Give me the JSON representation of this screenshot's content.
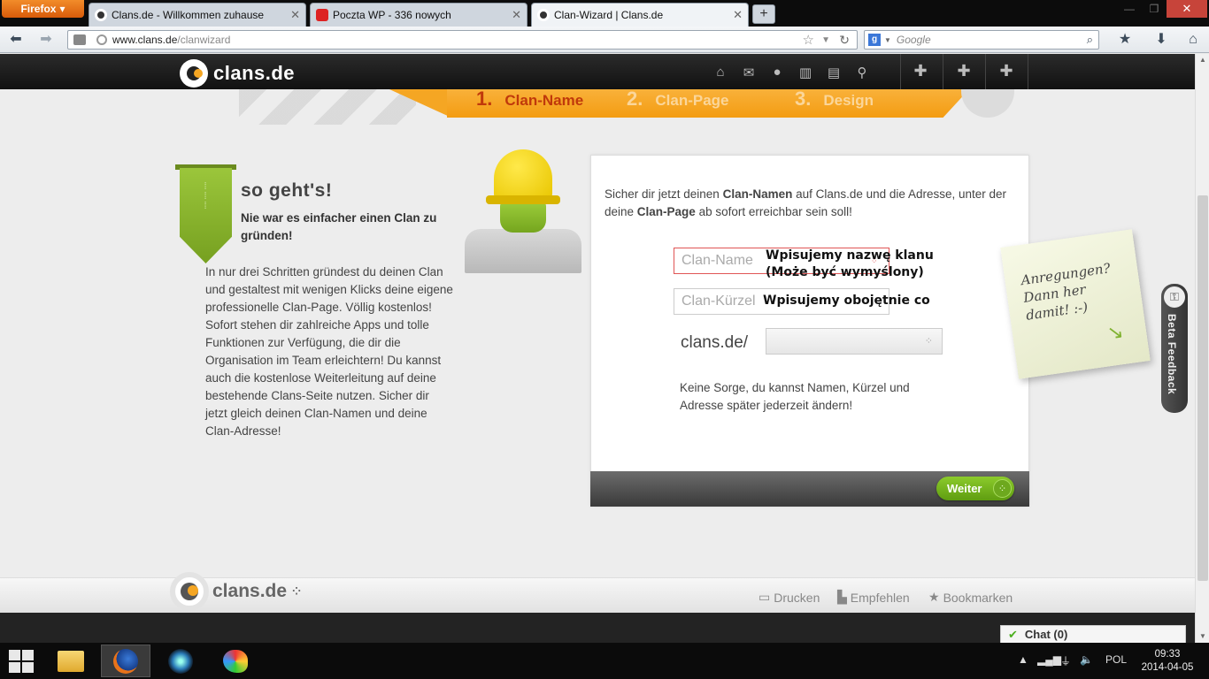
{
  "browser": {
    "menu_button": "Firefox",
    "tabs": [
      {
        "label": "Clans.de - Willkommen zuhause",
        "active": false
      },
      {
        "label": "Poczta WP - 336 nowych",
        "active": false
      },
      {
        "label": "Clan-Wizard | Clans.de",
        "active": true
      }
    ],
    "url_host": "www.clans.de",
    "url_path": "/clanwizard",
    "search_placeholder": "Google"
  },
  "site": {
    "logo_text": "clans.de",
    "steps": [
      {
        "num": "1.",
        "label": "Clan-Name"
      },
      {
        "num": "2.",
        "label": "Clan-Page"
      },
      {
        "num": "3.",
        "label": "Design"
      }
    ]
  },
  "howto": {
    "title": "so geht's!",
    "subtitle": "Nie war es einfacher einen Clan zu gründen!",
    "body": "In nur drei Schritten gründest du deinen Clan und gestaltest mit wenigen Klicks deine eigene professionelle Clan-Page. Völlig kostenlos! Sofort stehen dir zahlreiche Apps und tolle Funktionen zur Verfügung, die dir die Organisation im Team erleichtern! Du kannst auch die kostenlose Weiterleitung auf deine bestehende Clans-Seite nutzen. Sicher dir jetzt gleich deinen Clan-Namen und deine Clan-Adresse!"
  },
  "form": {
    "intro_1": "Sicher dir jetzt deinen ",
    "intro_b1": "Clan-Namen",
    "intro_2": " auf Clans.de und die Adresse, unter der deine ",
    "intro_b2": "Clan-Page",
    "intro_3": " ab sofort erreichbar sein soll!",
    "clan_name_placeholder": "Clan-Name",
    "clan_tag_placeholder": "Clan-Kürzel",
    "annotation_name": "Wpisujemy nazwę klanu\n(Może być wymyślony)",
    "annotation_tag": "Wpisujemy obojętnie co",
    "domain_prefix": "clans.de/",
    "domain_value": "",
    "note": "Keine Sorge, du kannst Namen, Kürzel und Adresse später jederzeit ändern!",
    "next_button": "Weiter"
  },
  "sticky_note": "Anregungen? Dann her damit! :-)",
  "beta_feedback": "Beta Feedback",
  "footer": {
    "logo_text": "clans.de",
    "links": [
      "Drucken",
      "Empfehlen",
      "Bookmarken"
    ]
  },
  "chat": "Chat (0)",
  "taskbar": {
    "language": "POL",
    "time": "09:33",
    "date": "2014-04-05"
  },
  "colors": {
    "brand_orange": "#f5a623",
    "brand_green": "#76a020",
    "header_dark": "#1a1a1a"
  }
}
